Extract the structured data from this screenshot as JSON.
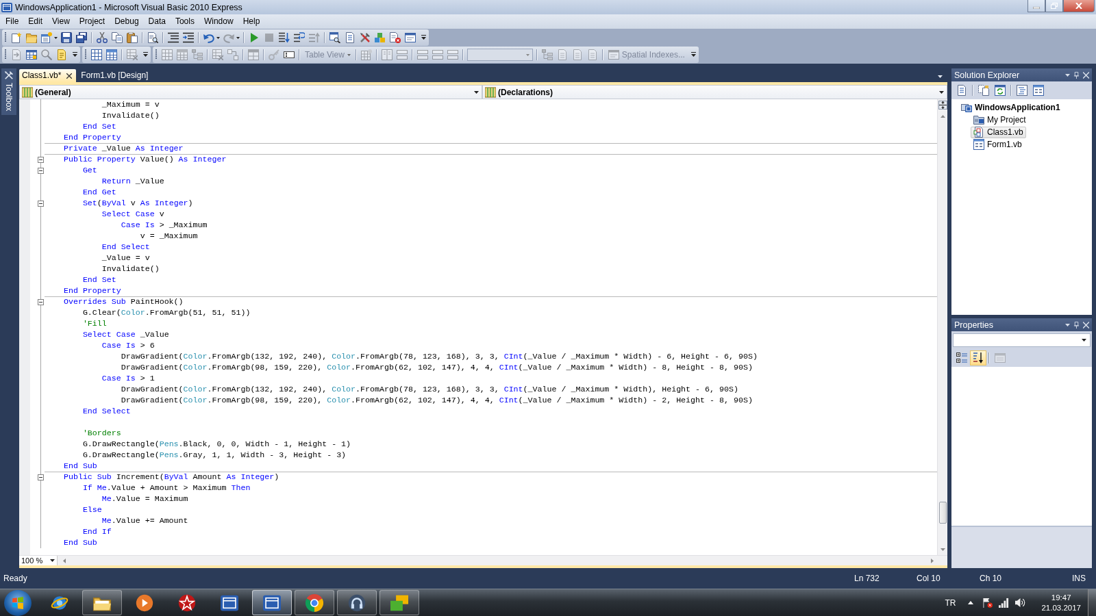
{
  "window": {
    "title": "WindowsApplication1 - Microsoft Visual Basic 2010 Express"
  },
  "menu": [
    "File",
    "Edit",
    "View",
    "Project",
    "Debug",
    "Data",
    "Tools",
    "Window",
    "Help"
  ],
  "toolbar_rows": [
    [
      {
        "groups": [
          [
            {
              "kind": "button",
              "disabled": false
            },
            {
              "kind": "button",
              "disabled": false
            },
            {
              "kind": "split",
              "disabled": false
            },
            {
              "kind": "button",
              "disabled": false
            },
            {
              "kind": "button",
              "disabled": false
            }
          ],
          [
            {
              "kind": "button",
              "disabled": false
            },
            {
              "kind": "button",
              "disabled": false
            },
            {
              "kind": "button",
              "disabled": false
            }
          ],
          [
            {
              "kind": "button",
              "disabled": false
            }
          ],
          [
            {
              "kind": "button",
              "disabled": false
            },
            {
              "kind": "button",
              "disabled": false
            }
          ],
          [
            {
              "kind": "split",
              "disabled": false
            },
            {
              "kind": "split",
              "disabled": true
            }
          ],
          [
            {
              "kind": "button",
              "disabled": false
            },
            {
              "kind": "button",
              "disabled": true
            },
            {
              "kind": "button",
              "disabled": false
            },
            {
              "kind": "button",
              "disabled": false
            },
            {
              "kind": "button",
              "disabled": true
            }
          ],
          [
            {
              "kind": "button",
              "disabled": false
            },
            {
              "kind": "button",
              "disabled": false
            },
            {
              "kind": "button",
              "disabled": false
            },
            {
              "kind": "button",
              "disabled": false
            },
            {
              "kind": "button",
              "disabled": false
            },
            {
              "kind": "button",
              "disabled": false
            }
          ]
        ]
      }
    ],
    [
      {
        "groups": [
          [
            {
              "kind": "button",
              "disabled": true
            },
            {
              "kind": "button",
              "disabled": false
            },
            {
              "kind": "button",
              "disabled": true
            },
            {
              "kind": "button",
              "disabled": false
            }
          ]
        ]
      },
      {
        "groups": [
          [
            {
              "kind": "button",
              "disabled": false
            },
            {
              "kind": "button",
              "disabled": false
            }
          ],
          [
            {
              "kind": "button",
              "disabled": true
            }
          ]
        ]
      },
      {
        "groups": [
          [
            {
              "kind": "button",
              "disabled": true
            },
            {
              "kind": "button",
              "disabled": true
            },
            {
              "kind": "button",
              "disabled": true
            }
          ],
          [
            {
              "kind": "button",
              "disabled": true
            },
            {
              "kind": "button",
              "disabled": true
            }
          ],
          [
            {
              "kind": "button",
              "disabled": true
            }
          ],
          [
            {
              "kind": "button",
              "disabled": true
            },
            {
              "kind": "button",
              "disabled": false
            }
          ],
          [
            {
              "kind": "menu",
              "label": "Table View",
              "disabled": true
            }
          ],
          [
            {
              "kind": "button",
              "disabled": true
            }
          ],
          [
            {
              "kind": "button",
              "disabled": true
            },
            {
              "kind": "button",
              "disabled": true
            }
          ],
          [
            {
              "kind": "button",
              "disabled": true
            },
            {
              "kind": "button",
              "disabled": true
            },
            {
              "kind": "button",
              "disabled": true
            }
          ],
          [
            {
              "kind": "combo",
              "disabled": true
            }
          ],
          [
            {
              "kind": "button",
              "disabled": true
            },
            {
              "kind": "button",
              "disabled": true
            },
            {
              "kind": "button",
              "disabled": true
            },
            {
              "kind": "button",
              "disabled": true
            }
          ],
          [
            {
              "kind": "labeled",
              "label": "Spatial Indexes...",
              "disabled": true
            }
          ]
        ]
      }
    ]
  ],
  "toolbox": {
    "label": "Toolbox"
  },
  "tabs": [
    {
      "label": "Class1.vb*",
      "selected": true
    },
    {
      "label": "Form1.vb [Design]",
      "selected": false
    }
  ],
  "navigation": [
    {
      "value": "(General)"
    },
    {
      "value": "(Declarations)"
    }
  ],
  "code": {
    "lines": [
      {
        "fold": false,
        "separator": false,
        "tokens": [
          {
            "kind": "plain",
            "text": "            _Maximum = v"
          }
        ]
      },
      {
        "fold": false,
        "separator": false,
        "tokens": [
          {
            "kind": "plain",
            "text": "            Invalidate()"
          }
        ]
      },
      {
        "fold": false,
        "separator": false,
        "tokens": [
          {
            "kind": "keyword",
            "text": "        End Set"
          }
        ]
      },
      {
        "fold": false,
        "separator": false,
        "tokens": [
          {
            "kind": "keyword",
            "text": "    End Property"
          }
        ]
      },
      {
        "fold": false,
        "separator": true,
        "tokens": [
          {
            "kind": "keyword",
            "text": "    Private"
          },
          {
            "kind": "plain",
            "text": " _Value "
          },
          {
            "kind": "keyword",
            "text": "As Integer"
          }
        ]
      },
      {
        "fold": true,
        "separator": true,
        "tokens": [
          {
            "kind": "keyword",
            "text": "    Public Property"
          },
          {
            "kind": "plain",
            "text": " Value() "
          },
          {
            "kind": "keyword",
            "text": "As Integer"
          }
        ]
      },
      {
        "fold": true,
        "separator": false,
        "tokens": [
          {
            "kind": "keyword",
            "text": "        Get"
          }
        ]
      },
      {
        "fold": false,
        "separator": false,
        "tokens": [
          {
            "kind": "keyword",
            "text": "            Return"
          },
          {
            "kind": "plain",
            "text": " _Value"
          }
        ]
      },
      {
        "fold": false,
        "separator": false,
        "tokens": [
          {
            "kind": "keyword",
            "text": "        End Get"
          }
        ]
      },
      {
        "fold": true,
        "separator": false,
        "tokens": [
          {
            "kind": "keyword",
            "text": "        Set"
          },
          {
            "kind": "plain",
            "text": "("
          },
          {
            "kind": "keyword",
            "text": "ByVal"
          },
          {
            "kind": "plain",
            "text": " v "
          },
          {
            "kind": "keyword",
            "text": "As Integer"
          },
          {
            "kind": "plain",
            "text": ")"
          }
        ]
      },
      {
        "fold": false,
        "separator": false,
        "tokens": [
          {
            "kind": "keyword",
            "text": "            Select Case"
          },
          {
            "kind": "plain",
            "text": " v"
          }
        ]
      },
      {
        "fold": false,
        "separator": false,
        "tokens": [
          {
            "kind": "keyword",
            "text": "                Case Is"
          },
          {
            "kind": "plain",
            "text": " > _Maximum"
          }
        ]
      },
      {
        "fold": false,
        "separator": false,
        "tokens": [
          {
            "kind": "plain",
            "text": "                    v = _Maximum"
          }
        ]
      },
      {
        "fold": false,
        "separator": false,
        "tokens": [
          {
            "kind": "keyword",
            "text": "            End Select"
          }
        ]
      },
      {
        "fold": false,
        "separator": false,
        "tokens": [
          {
            "kind": "plain",
            "text": "            _Value = v"
          }
        ]
      },
      {
        "fold": false,
        "separator": false,
        "tokens": [
          {
            "kind": "plain",
            "text": "            Invalidate()"
          }
        ]
      },
      {
        "fold": false,
        "separator": false,
        "tokens": [
          {
            "kind": "keyword",
            "text": "        End Set"
          }
        ]
      },
      {
        "fold": false,
        "separator": false,
        "tokens": [
          {
            "kind": "keyword",
            "text": "    End Property"
          }
        ]
      },
      {
        "fold": true,
        "separator": true,
        "tokens": [
          {
            "kind": "keyword",
            "text": "    Overrides Sub"
          },
          {
            "kind": "plain",
            "text": " PaintHook()"
          }
        ]
      },
      {
        "fold": false,
        "separator": false,
        "tokens": [
          {
            "kind": "plain",
            "text": "        G.Clear("
          },
          {
            "kind": "type",
            "text": "Color"
          },
          {
            "kind": "plain",
            "text": ".FromArgb(51, 51, 51))"
          }
        ]
      },
      {
        "fold": false,
        "separator": false,
        "tokens": [
          {
            "kind": "comment",
            "text": "        'Fill"
          }
        ]
      },
      {
        "fold": false,
        "separator": false,
        "tokens": [
          {
            "kind": "keyword",
            "text": "        Select Case"
          },
          {
            "kind": "plain",
            "text": " _Value"
          }
        ]
      },
      {
        "fold": false,
        "separator": false,
        "tokens": [
          {
            "kind": "keyword",
            "text": "            Case Is"
          },
          {
            "kind": "plain",
            "text": " > 6"
          }
        ]
      },
      {
        "fold": false,
        "separator": false,
        "tokens": [
          {
            "kind": "plain",
            "text": "                DrawGradient("
          },
          {
            "kind": "type",
            "text": "Color"
          },
          {
            "kind": "plain",
            "text": ".FromArgb(132, 192, 240), "
          },
          {
            "kind": "type",
            "text": "Color"
          },
          {
            "kind": "plain",
            "text": ".FromArgb(78, 123, 168), 3, 3, "
          },
          {
            "kind": "keyword",
            "text": "CInt"
          },
          {
            "kind": "plain",
            "text": "(_Value / _Maximum * Width) - 6, Height - 6, 90S)"
          }
        ]
      },
      {
        "fold": false,
        "separator": false,
        "tokens": [
          {
            "kind": "plain",
            "text": "                DrawGradient("
          },
          {
            "kind": "type",
            "text": "Color"
          },
          {
            "kind": "plain",
            "text": ".FromArgb(98, 159, 220), "
          },
          {
            "kind": "type",
            "text": "Color"
          },
          {
            "kind": "plain",
            "text": ".FromArgb(62, 102, 147), 4, 4, "
          },
          {
            "kind": "keyword",
            "text": "CInt"
          },
          {
            "kind": "plain",
            "text": "(_Value / _Maximum * Width) - 8, Height - 8, 90S)"
          }
        ]
      },
      {
        "fold": false,
        "separator": false,
        "tokens": [
          {
            "kind": "keyword",
            "text": "            Case Is"
          },
          {
            "kind": "plain",
            "text": " > 1"
          }
        ]
      },
      {
        "fold": false,
        "separator": false,
        "tokens": [
          {
            "kind": "plain",
            "text": "                DrawGradient("
          },
          {
            "kind": "type",
            "text": "Color"
          },
          {
            "kind": "plain",
            "text": ".FromArgb(132, 192, 240), "
          },
          {
            "kind": "type",
            "text": "Color"
          },
          {
            "kind": "plain",
            "text": ".FromArgb(78, 123, 168), 3, 3, "
          },
          {
            "kind": "keyword",
            "text": "CInt"
          },
          {
            "kind": "plain",
            "text": "(_Value / _Maximum * Width), Height - 6, 90S)"
          }
        ]
      },
      {
        "fold": false,
        "separator": false,
        "tokens": [
          {
            "kind": "plain",
            "text": "                DrawGradient("
          },
          {
            "kind": "type",
            "text": "Color"
          },
          {
            "kind": "plain",
            "text": ".FromArgb(98, 159, 220), "
          },
          {
            "kind": "type",
            "text": "Color"
          },
          {
            "kind": "plain",
            "text": ".FromArgb(62, 102, 147), 4, 4, "
          },
          {
            "kind": "keyword",
            "text": "CInt"
          },
          {
            "kind": "plain",
            "text": "(_Value / _Maximum * Width) - 2, Height - 8, 90S)"
          }
        ]
      },
      {
        "fold": false,
        "separator": false,
        "tokens": [
          {
            "kind": "keyword",
            "text": "        End Select"
          }
        ]
      },
      {
        "fold": false,
        "separator": false
      },
      {
        "fold": false,
        "separator": false,
        "tokens": [
          {
            "kind": "comment",
            "text": "        'Borders"
          }
        ]
      },
      {
        "fold": false,
        "separator": false,
        "tokens": [
          {
            "kind": "plain",
            "text": "        G.DrawRectangle("
          },
          {
            "kind": "type",
            "text": "Pens"
          },
          {
            "kind": "plain",
            "text": ".Black, 0, 0, Width - 1, Height - 1)"
          }
        ]
      },
      {
        "fold": false,
        "separator": false,
        "tokens": [
          {
            "kind": "plain",
            "text": "        G.DrawRectangle("
          },
          {
            "kind": "type",
            "text": "Pens"
          },
          {
            "kind": "plain",
            "text": ".Gray, 1, 1, Width - 3, Height - 3)"
          }
        ]
      },
      {
        "fold": false,
        "separator": false,
        "tokens": [
          {
            "kind": "keyword",
            "text": "    End Sub"
          }
        ]
      },
      {
        "fold": true,
        "separator": true,
        "tokens": [
          {
            "kind": "keyword",
            "text": "    Public Sub"
          },
          {
            "kind": "plain",
            "text": " Increment("
          },
          {
            "kind": "keyword",
            "text": "ByVal"
          },
          {
            "kind": "plain",
            "text": " Amount "
          },
          {
            "kind": "keyword",
            "text": "As Integer"
          },
          {
            "kind": "plain",
            "text": ")"
          }
        ]
      },
      {
        "fold": false,
        "separator": false,
        "tokens": [
          {
            "kind": "keyword",
            "text": "        If Me"
          },
          {
            "kind": "plain",
            "text": ".Value + Amount > Maximum "
          },
          {
            "kind": "keyword",
            "text": "Then"
          }
        ]
      },
      {
        "fold": false,
        "separator": false,
        "tokens": [
          {
            "kind": "keyword",
            "text": "            Me"
          },
          {
            "kind": "plain",
            "text": ".Value = Maximum"
          }
        ]
      },
      {
        "fold": false,
        "separator": false,
        "tokens": [
          {
            "kind": "keyword",
            "text": "        Else"
          }
        ]
      },
      {
        "fold": false,
        "separator": false,
        "tokens": [
          {
            "kind": "keyword",
            "text": "            Me"
          },
          {
            "kind": "plain",
            "text": ".Value += Amount"
          }
        ]
      },
      {
        "fold": false,
        "separator": false,
        "tokens": [
          {
            "kind": "keyword",
            "text": "        End If"
          }
        ]
      },
      {
        "fold": false,
        "separator": false,
        "tokens": [
          {
            "kind": "keyword",
            "text": "    End Sub"
          }
        ]
      }
    ]
  },
  "editor": {
    "zoom": "100 %"
  },
  "solution_explorer": {
    "title": "Solution Explorer",
    "tree": [
      {
        "label": "WindowsApplication1",
        "kind": "project",
        "selected": false,
        "children": [
          {
            "label": "My Project",
            "kind": "properties",
            "selected": false
          },
          {
            "label": "Class1.vb",
            "kind": "class",
            "selected": true
          },
          {
            "label": "Form1.vb",
            "kind": "form",
            "selected": false
          }
        ]
      }
    ]
  },
  "properties": {
    "title": "Properties",
    "toolbar": [
      {
        "kind": "toggle",
        "selected": false
      },
      {
        "kind": "toggle",
        "selected": true
      },
      {
        "kind": "button",
        "disabled": true
      }
    ]
  },
  "status_bar": {
    "message": "Ready",
    "line": "Ln 732",
    "column": "Col 10",
    "character": "Ch 10",
    "mode": "INS"
  },
  "taskbar": {
    "apps": [
      {
        "running": false,
        "selected": false
      },
      {
        "running": true,
        "selected": false
      },
      {
        "running": false,
        "selected": false
      },
      {
        "running": false,
        "selected": false
      },
      {
        "running": false,
        "selected": false
      },
      {
        "running": true,
        "selected": true
      },
      {
        "running": true,
        "selected": false
      },
      {
        "running": true,
        "selected": false
      },
      {
        "running": true,
        "selected": false
      }
    ],
    "tray": {
      "language": "TR",
      "time": "19:47",
      "date": "21.03.2017"
    }
  }
}
